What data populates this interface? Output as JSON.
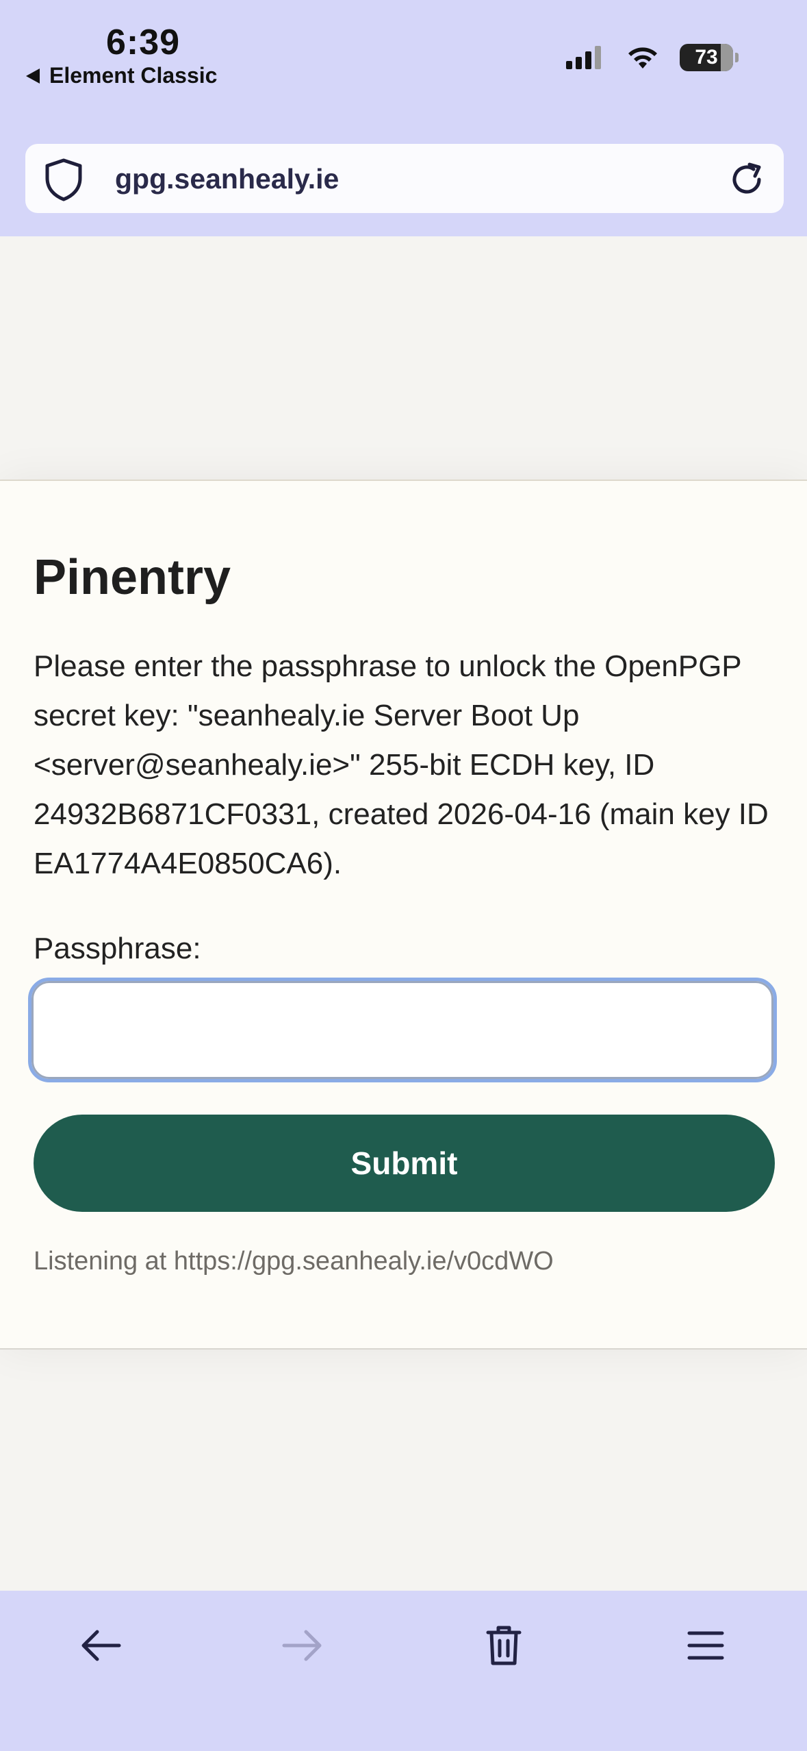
{
  "status_bar": {
    "time": "6:39",
    "back_app": "Element Classic",
    "battery": "73"
  },
  "browser": {
    "url": "gpg.seanhealy.ie",
    "icons": [
      "shield-icon",
      "reload-icon"
    ]
  },
  "dialog": {
    "title": "Pinentry",
    "description": "Please enter the passphrase to unlock the OpenPGP secret key: \"seanhealy.ie Server Boot Up <server@seanhealy.ie>\" 255-bit ECDH key, ID 24932B6871CF0331, created 2026-04-16 (main key ID EA1774A4E0850CA6).",
    "passphrase_label": "Passphrase:",
    "passphrase_value": "",
    "submit_label": "Submit",
    "listening": "Listening at https://gpg.seanhealy.ie/v0cdWO"
  },
  "toolbar": {
    "icons": [
      "back-arrow-icon",
      "forward-arrow-icon",
      "trash-icon",
      "menu-icon"
    ]
  },
  "colors": {
    "chrome": "#d5d6f9",
    "accent_button": "#1f5c4e",
    "focus_ring": "#8aabe6",
    "card_bg": "#fdfcf7"
  }
}
